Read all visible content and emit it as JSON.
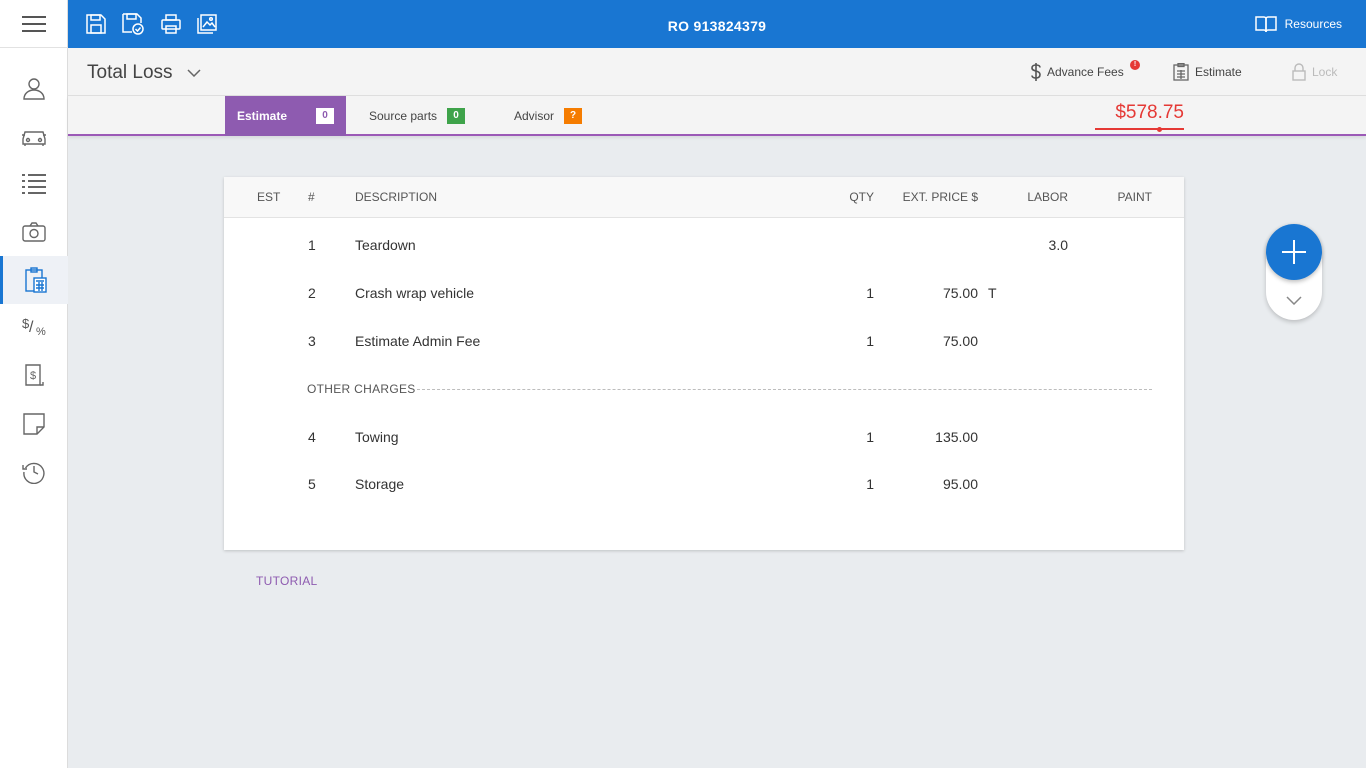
{
  "header": {
    "ro_number": "RO 913824379",
    "resources_label": "Resources"
  },
  "toolbar": {
    "icons": [
      "save-icon",
      "save-check-icon",
      "print-icon",
      "gallery-icon"
    ]
  },
  "sidebar": {
    "items": [
      {
        "icon": "person-icon"
      },
      {
        "icon": "car-icon"
      },
      {
        "icon": "list-icon"
      },
      {
        "icon": "camera-icon"
      },
      {
        "icon": "calculator-clipboard-icon",
        "active": true
      },
      {
        "icon": "dollar-percent-icon",
        "label_top": "$",
        "label_bottom": "%"
      },
      {
        "icon": "invoice-icon"
      },
      {
        "icon": "note-icon"
      },
      {
        "icon": "history-icon"
      }
    ]
  },
  "subheader": {
    "title": "Total Loss",
    "advance_fees_label": "Advance Fees",
    "advance_fees_alert": "!",
    "estimate_label": "Estimate",
    "lock_label": "Lock"
  },
  "tabs": [
    {
      "label": "Estimate",
      "count": "0",
      "active": true,
      "badge_color": "#ffffff"
    },
    {
      "label": "Source parts",
      "count": "0",
      "badge_color": "#3ea34a"
    },
    {
      "label": "Advisor",
      "count": "?",
      "badge_color": "#f57c00"
    }
  ],
  "total": "$578.75",
  "table": {
    "headers": {
      "est": "EST",
      "num": "#",
      "description": "DESCRIPTION",
      "qty": "QTY",
      "ext_price": "EXT. PRICE $",
      "labor": "LABOR",
      "paint": "PAINT"
    },
    "rows": [
      {
        "num": "1",
        "description": "Teardown",
        "qty": "",
        "ext_price": "",
        "flag": "",
        "labor": "3.0",
        "paint": ""
      },
      {
        "num": "2",
        "description": "Crash wrap vehicle",
        "qty": "1",
        "ext_price": "75.00",
        "flag": "T",
        "labor": "",
        "paint": ""
      },
      {
        "num": "3",
        "description": "Estimate Admin Fee",
        "qty": "1",
        "ext_price": "75.00",
        "flag": "",
        "labor": "",
        "paint": ""
      },
      {
        "num": "4",
        "description": "Towing",
        "qty": "1",
        "ext_price": "135.00",
        "flag": "",
        "labor": "",
        "paint": ""
      },
      {
        "num": "5",
        "description": "Storage",
        "qty": "1",
        "ext_price": "95.00",
        "flag": "",
        "labor": "",
        "paint": ""
      }
    ],
    "section_label": "OTHER CHARGES"
  },
  "tutorial_label": "TUTORIAL",
  "colors": {
    "primary": "#1976d2",
    "accent": "#8e5bb0",
    "total": "#e53935"
  }
}
